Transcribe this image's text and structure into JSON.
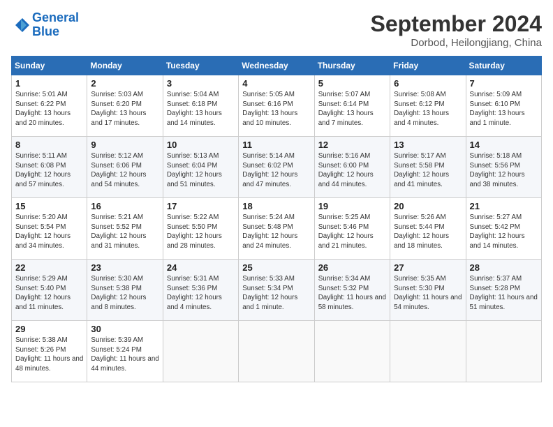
{
  "header": {
    "logo_line1": "General",
    "logo_line2": "Blue",
    "month": "September 2024",
    "location": "Dorbod, Heilongjiang, China"
  },
  "weekdays": [
    "Sunday",
    "Monday",
    "Tuesday",
    "Wednesday",
    "Thursday",
    "Friday",
    "Saturday"
  ],
  "weeks": [
    [
      {
        "day": "1",
        "sunrise": "5:01 AM",
        "sunset": "6:22 PM",
        "daylight": "13 hours and 20 minutes."
      },
      {
        "day": "2",
        "sunrise": "5:03 AM",
        "sunset": "6:20 PM",
        "daylight": "13 hours and 17 minutes."
      },
      {
        "day": "3",
        "sunrise": "5:04 AM",
        "sunset": "6:18 PM",
        "daylight": "13 hours and 14 minutes."
      },
      {
        "day": "4",
        "sunrise": "5:05 AM",
        "sunset": "6:16 PM",
        "daylight": "13 hours and 10 minutes."
      },
      {
        "day": "5",
        "sunrise": "5:07 AM",
        "sunset": "6:14 PM",
        "daylight": "13 hours and 7 minutes."
      },
      {
        "day": "6",
        "sunrise": "5:08 AM",
        "sunset": "6:12 PM",
        "daylight": "13 hours and 4 minutes."
      },
      {
        "day": "7",
        "sunrise": "5:09 AM",
        "sunset": "6:10 PM",
        "daylight": "13 hours and 1 minute."
      }
    ],
    [
      {
        "day": "8",
        "sunrise": "5:11 AM",
        "sunset": "6:08 PM",
        "daylight": "12 hours and 57 minutes."
      },
      {
        "day": "9",
        "sunrise": "5:12 AM",
        "sunset": "6:06 PM",
        "daylight": "12 hours and 54 minutes."
      },
      {
        "day": "10",
        "sunrise": "5:13 AM",
        "sunset": "6:04 PM",
        "daylight": "12 hours and 51 minutes."
      },
      {
        "day": "11",
        "sunrise": "5:14 AM",
        "sunset": "6:02 PM",
        "daylight": "12 hours and 47 minutes."
      },
      {
        "day": "12",
        "sunrise": "5:16 AM",
        "sunset": "6:00 PM",
        "daylight": "12 hours and 44 minutes."
      },
      {
        "day": "13",
        "sunrise": "5:17 AM",
        "sunset": "5:58 PM",
        "daylight": "12 hours and 41 minutes."
      },
      {
        "day": "14",
        "sunrise": "5:18 AM",
        "sunset": "5:56 PM",
        "daylight": "12 hours and 38 minutes."
      }
    ],
    [
      {
        "day": "15",
        "sunrise": "5:20 AM",
        "sunset": "5:54 PM",
        "daylight": "12 hours and 34 minutes."
      },
      {
        "day": "16",
        "sunrise": "5:21 AM",
        "sunset": "5:52 PM",
        "daylight": "12 hours and 31 minutes."
      },
      {
        "day": "17",
        "sunrise": "5:22 AM",
        "sunset": "5:50 PM",
        "daylight": "12 hours and 28 minutes."
      },
      {
        "day": "18",
        "sunrise": "5:24 AM",
        "sunset": "5:48 PM",
        "daylight": "12 hours and 24 minutes."
      },
      {
        "day": "19",
        "sunrise": "5:25 AM",
        "sunset": "5:46 PM",
        "daylight": "12 hours and 21 minutes."
      },
      {
        "day": "20",
        "sunrise": "5:26 AM",
        "sunset": "5:44 PM",
        "daylight": "12 hours and 18 minutes."
      },
      {
        "day": "21",
        "sunrise": "5:27 AM",
        "sunset": "5:42 PM",
        "daylight": "12 hours and 14 minutes."
      }
    ],
    [
      {
        "day": "22",
        "sunrise": "5:29 AM",
        "sunset": "5:40 PM",
        "daylight": "12 hours and 11 minutes."
      },
      {
        "day": "23",
        "sunrise": "5:30 AM",
        "sunset": "5:38 PM",
        "daylight": "12 hours and 8 minutes."
      },
      {
        "day": "24",
        "sunrise": "5:31 AM",
        "sunset": "5:36 PM",
        "daylight": "12 hours and 4 minutes."
      },
      {
        "day": "25",
        "sunrise": "5:33 AM",
        "sunset": "5:34 PM",
        "daylight": "12 hours and 1 minute."
      },
      {
        "day": "26",
        "sunrise": "5:34 AM",
        "sunset": "5:32 PM",
        "daylight": "11 hours and 58 minutes."
      },
      {
        "day": "27",
        "sunrise": "5:35 AM",
        "sunset": "5:30 PM",
        "daylight": "11 hours and 54 minutes."
      },
      {
        "day": "28",
        "sunrise": "5:37 AM",
        "sunset": "5:28 PM",
        "daylight": "11 hours and 51 minutes."
      }
    ],
    [
      {
        "day": "29",
        "sunrise": "5:38 AM",
        "sunset": "5:26 PM",
        "daylight": "11 hours and 48 minutes."
      },
      {
        "day": "30",
        "sunrise": "5:39 AM",
        "sunset": "5:24 PM",
        "daylight": "11 hours and 44 minutes."
      },
      null,
      null,
      null,
      null,
      null
    ]
  ]
}
